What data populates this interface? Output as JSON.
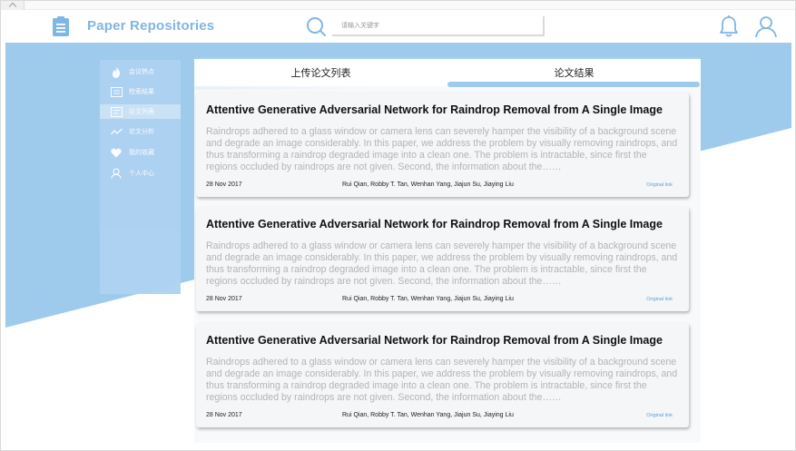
{
  "app": {
    "brand_title": "Paper Repositories"
  },
  "header": {
    "search_placeholder": "请输入关键字"
  },
  "sidebar": {
    "items": [
      {
        "label": "会议热点",
        "icon": "flame-icon"
      },
      {
        "label": "检索结果",
        "icon": "document-icon"
      },
      {
        "label": "论文列表",
        "icon": "list-icon",
        "active": true
      },
      {
        "label": "论文分析",
        "icon": "trend-icon"
      },
      {
        "label": "我的收藏",
        "icon": "heart-icon"
      },
      {
        "label": "个人中心",
        "icon": "person-icon"
      }
    ]
  },
  "tabs": {
    "upload": "上传论文列表",
    "results": "论文结果"
  },
  "papers": [
    {
      "title": "Attentive Generative Adversarial Network for Raindrop Removal from A Single Image",
      "abstract": "Raindrops adhered to a glass window or camera lens can severely hamper the visibility of a background scene and degrade an image considerably. In this paper, we address the problem by visually removing raindrops, and thus transforming a raindrop degraded image into a clean one. The problem is intractable, since first the regions occluded by raindrops are not given. Second, the information about the……",
      "date": "28 Nov 2017",
      "authors": "Rui Qian, Robby T. Tan, Wenhan Yang, Jiajun Su, Jiaying Liu",
      "link": "Original link"
    },
    {
      "title": "Attentive Generative Adversarial Network for Raindrop Removal from A Single Image",
      "abstract": "Raindrops adhered to a glass window or camera lens can severely hamper the visibility of a background scene and degrade an image considerably. In this paper, we address the problem by visually removing raindrops, and thus transforming a raindrop degraded image into a clean one. The problem is intractable, since first the regions occluded by raindrops are not given. Second, the information about the……",
      "date": "28 Nov 2017",
      "authors": "Rui Qian, Robby T. Tan, Wenhan Yang, Jiajun Su, Jiaying Liu",
      "link": "Original link"
    },
    {
      "title": "Attentive Generative Adversarial Network for Raindrop Removal from A Single Image",
      "abstract": "Raindrops adhered to a glass window or camera lens can severely hamper the visibility of a background scene and degrade an image considerably. In this paper, we address the problem by visually removing raindrops, and thus transforming a raindrop degraded image into a clean one. The problem is intractable, since first the regions occluded by raindrops are not given. Second, the information about the……",
      "date": "28 Nov 2017",
      "authors": "Rui Qian, Robby T. Tan, Wenhan Yang, Jiajun Su, Jiaying Liu",
      "link": "Original link"
    }
  ],
  "colors": {
    "accent": "#7fb6e4",
    "background_band": "#9ecbec",
    "sidebar": "#aed2f2",
    "link": "#5a9fe0"
  }
}
